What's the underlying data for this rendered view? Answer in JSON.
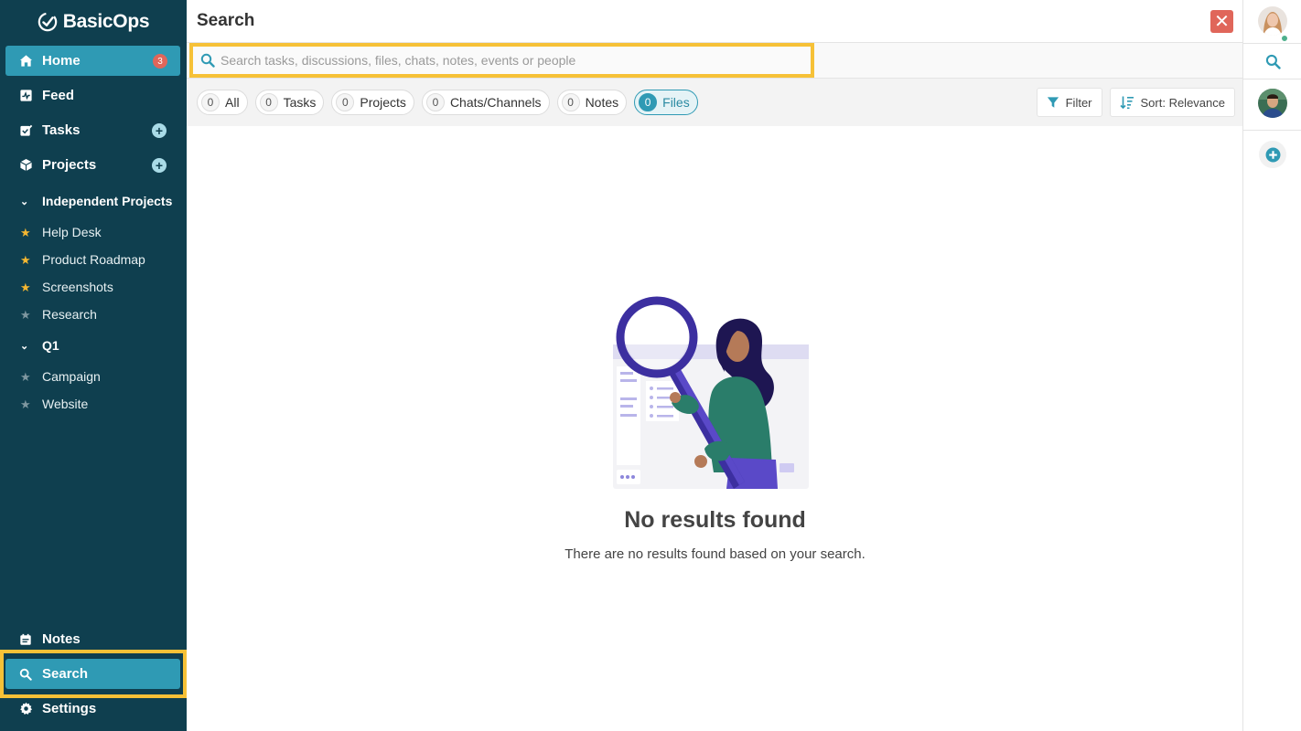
{
  "app": {
    "name": "BasicOps"
  },
  "sidebar": {
    "home": {
      "label": "Home",
      "badge": "3"
    },
    "feed": {
      "label": "Feed"
    },
    "tasks": {
      "label": "Tasks"
    },
    "projects": {
      "label": "Projects"
    },
    "groups": [
      {
        "label": "Independent Projects",
        "items": [
          {
            "label": "Help Desk",
            "favorite": true
          },
          {
            "label": "Product Roadmap",
            "favorite": true
          },
          {
            "label": "Screenshots",
            "favorite": true
          },
          {
            "label": "Research",
            "favorite": false
          }
        ]
      },
      {
        "label": "Q1",
        "items": [
          {
            "label": "Campaign",
            "favorite": false
          },
          {
            "label": "Website",
            "favorite": false
          }
        ]
      }
    ],
    "notes": {
      "label": "Notes"
    },
    "search": {
      "label": "Search"
    },
    "settings": {
      "label": "Settings"
    }
  },
  "header": {
    "title": "Search"
  },
  "search": {
    "placeholder": "Search tasks, discussions, files, chats, notes, events or people",
    "value": ""
  },
  "filters": {
    "chips": [
      {
        "count": "0",
        "label": "All"
      },
      {
        "count": "0",
        "label": "Tasks"
      },
      {
        "count": "0",
        "label": "Projects"
      },
      {
        "count": "0",
        "label": "Chats/Channels"
      },
      {
        "count": "0",
        "label": "Notes"
      },
      {
        "count": "0",
        "label": "Files",
        "active": true
      }
    ],
    "filter_label": "Filter",
    "sort_label": "Sort: Relevance"
  },
  "empty_state": {
    "title": "No results found",
    "message": "There are no results found based on your search."
  },
  "colors": {
    "sidebar_bg": "#0f3f4f",
    "accent": "#2f9ab4",
    "highlight": "#f6c137",
    "close": "#e0665a"
  }
}
